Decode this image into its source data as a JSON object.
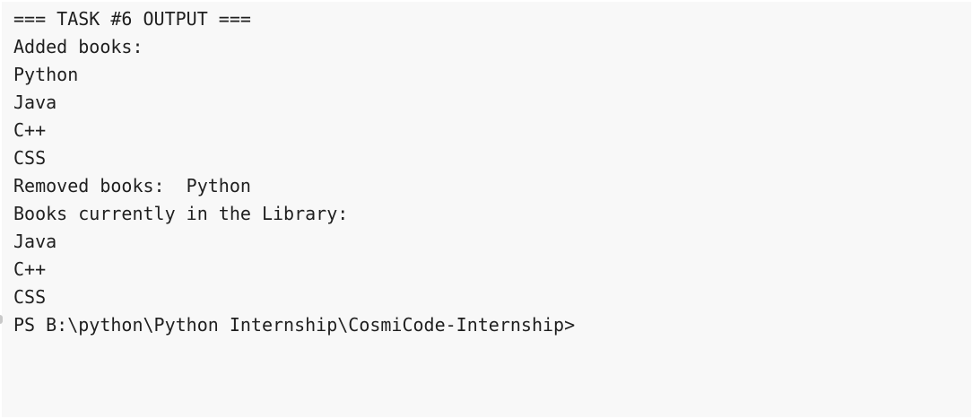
{
  "terminal": {
    "lines": [
      "=== TASK #6 OUTPUT ===",
      "Added books:",
      "Python",
      "Java",
      "C++",
      "CSS",
      "Removed books:  Python",
      "Books currently in the Library:",
      "Java",
      "C++",
      "CSS"
    ],
    "prompt": "PS B:\\python\\Python Internship\\CosmiCode-Internship>"
  }
}
